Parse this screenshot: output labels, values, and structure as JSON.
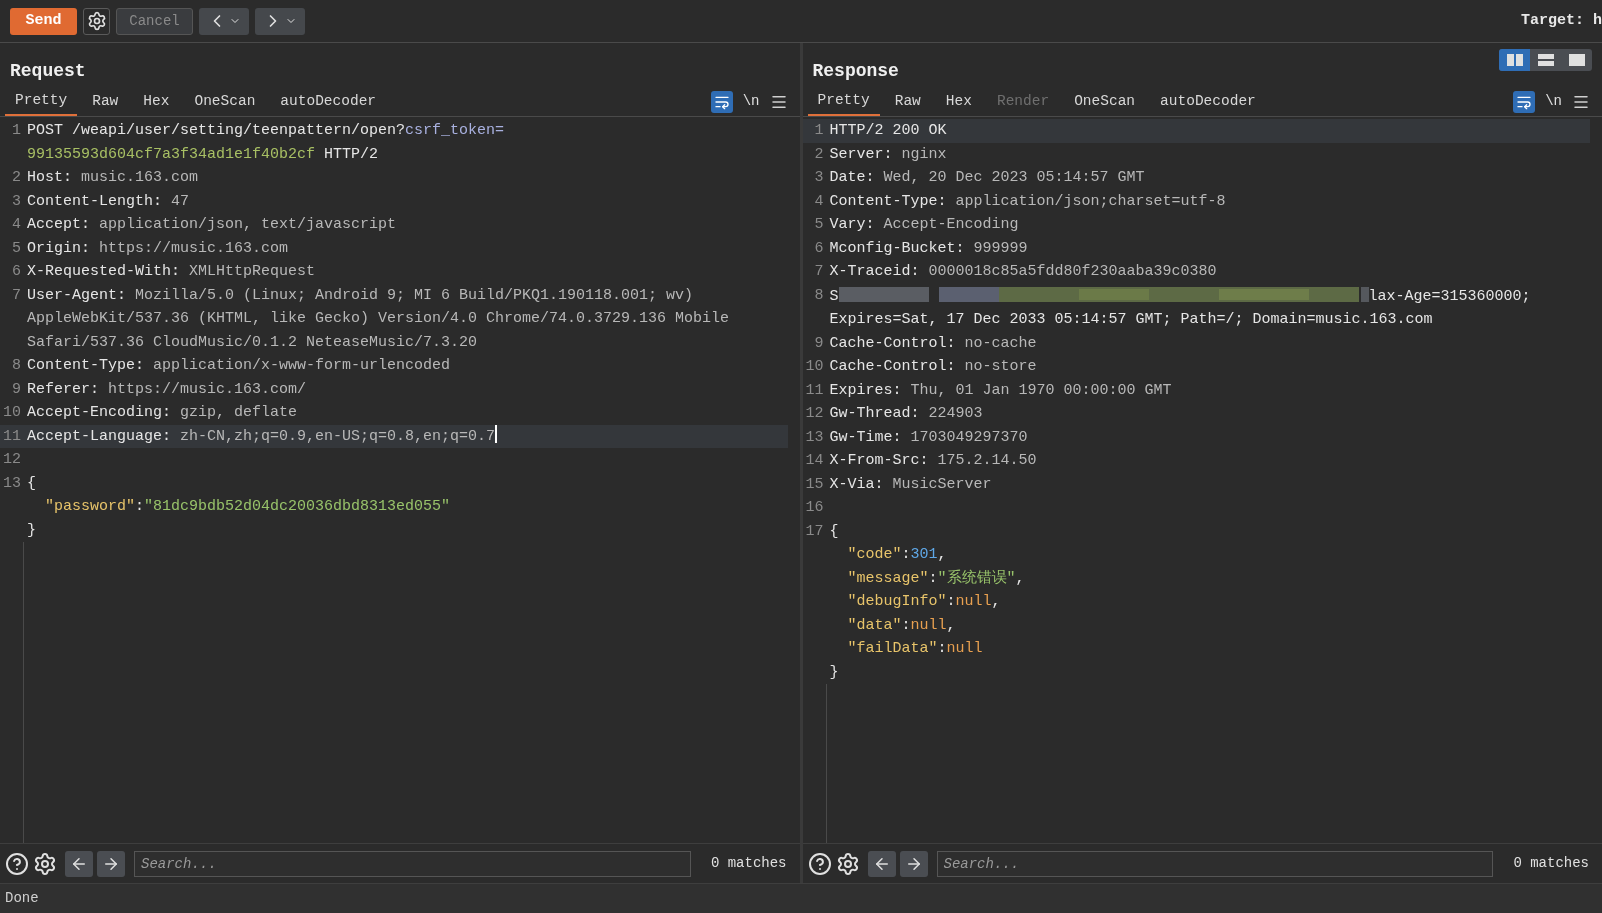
{
  "toolbar": {
    "send": "Send",
    "cancel": "Cancel",
    "cancel_disabled": true,
    "target": "Target: h"
  },
  "panels": [
    {
      "title": "Request",
      "tabs": [
        {
          "label": "Pretty",
          "selected": true,
          "disabled": false
        },
        {
          "label": "Raw",
          "selected": false,
          "disabled": false
        },
        {
          "label": "Hex",
          "selected": false,
          "disabled": false
        },
        {
          "label": "OneScan",
          "selected": false,
          "disabled": false
        },
        {
          "label": "autoDecoder",
          "selected": false,
          "disabled": false
        }
      ],
      "wrap_on": true,
      "newline_toggle": "\\n",
      "lines": [
        {
          "number": "1",
          "highlighted": false,
          "cursor": false,
          "segments": [
            {
              "kind": "key",
              "text": "POST /weapi/user/setting/teenpattern/open?"
            },
            {
              "kind": "param",
              "text": "csrf_token="
            },
            {
              "kind": "param_value",
              "text": "99135593d604cf7a3f34ad1e1f40b2cf"
            },
            {
              "kind": "key",
              "text": " HTTP/2"
            }
          ]
        },
        {
          "number": "2",
          "highlighted": false,
          "cursor": false,
          "segments": [
            {
              "kind": "key",
              "text": "Host:"
            },
            {
              "kind": "value",
              "text": " music.163.com"
            }
          ]
        },
        {
          "number": "3",
          "highlighted": false,
          "cursor": false,
          "segments": [
            {
              "kind": "key",
              "text": "Content-Length:"
            },
            {
              "kind": "value",
              "text": " 47"
            }
          ]
        },
        {
          "number": "4",
          "highlighted": false,
          "cursor": false,
          "segments": [
            {
              "kind": "key",
              "text": "Accept:"
            },
            {
              "kind": "value",
              "text": " application/json, text/javascript"
            }
          ]
        },
        {
          "number": "5",
          "highlighted": false,
          "cursor": false,
          "segments": [
            {
              "kind": "key",
              "text": "Origin:"
            },
            {
              "kind": "value",
              "text": " https://music.163.com"
            }
          ]
        },
        {
          "number": "6",
          "highlighted": false,
          "cursor": false,
          "segments": [
            {
              "kind": "key",
              "text": "X-Requested-With:"
            },
            {
              "kind": "value",
              "text": " XMLHttpRequest"
            }
          ]
        },
        {
          "number": "7",
          "highlighted": false,
          "cursor": false,
          "segments": [
            {
              "kind": "key",
              "text": "User-Agent:"
            },
            {
              "kind": "value",
              "text": " Mozilla/5.0 (Linux; Android 9; MI 6 Build/PKQ1.190118.001; wv) AppleWebKit/537.36 (KHTML, like Gecko) Version/4.0 Chrome/74.0.3729.136 Mobile Safari/537.36 CloudMusic/0.1.2 NeteaseMusic/7.3.20"
            }
          ]
        },
        {
          "number": "8",
          "highlighted": false,
          "cursor": false,
          "segments": [
            {
              "kind": "key",
              "text": "Content-Type:"
            },
            {
              "kind": "value",
              "text": " application/x-www-form-urlencoded"
            }
          ]
        },
        {
          "number": "9",
          "highlighted": false,
          "cursor": false,
          "segments": [
            {
              "kind": "key",
              "text": "Referer:"
            },
            {
              "kind": "value",
              "text": " https://music.163.com/"
            }
          ]
        },
        {
          "number": "10",
          "highlighted": false,
          "cursor": false,
          "segments": [
            {
              "kind": "key",
              "text": "Accept-Encoding:"
            },
            {
              "kind": "value",
              "text": " gzip, deflate"
            }
          ]
        },
        {
          "number": "11",
          "highlighted": true,
          "cursor": true,
          "segments": [
            {
              "kind": "key",
              "text": "Accept-Language:"
            },
            {
              "kind": "value",
              "text": " zh-CN,zh;q=0.9,en-US;q=0.8,en;q=0.7"
            }
          ]
        },
        {
          "number": "12",
          "highlighted": false,
          "cursor": false
        },
        {
          "number": "13",
          "highlighted": false,
          "cursor": false,
          "segments": [
            {
              "kind": "key",
              "text": "{\n  "
            },
            {
              "kind": "json_key",
              "text": "\"password\""
            },
            {
              "kind": "key",
              "text": ":"
            },
            {
              "kind": "json_string",
              "text": "\"81dc9bdb52d04dc20036dbd8313ed055\""
            },
            {
              "kind": "key",
              "text": "\n}"
            }
          ]
        }
      ],
      "search": {
        "placeholder": "Search...",
        "matches": "0 matches"
      }
    },
    {
      "title": "Response",
      "layout_toggle": [
        {
          "selected": true
        },
        {
          "selected": false
        },
        {
          "selected": false
        }
      ],
      "tabs": [
        {
          "label": "Pretty",
          "selected": true,
          "disabled": false
        },
        {
          "label": "Raw",
          "selected": false,
          "disabled": false
        },
        {
          "label": "Hex",
          "selected": false,
          "disabled": false
        },
        {
          "label": "Render",
          "selected": false,
          "disabled": true
        },
        {
          "label": "OneScan",
          "selected": false,
          "disabled": false
        },
        {
          "label": "autoDecoder",
          "selected": false,
          "disabled": false
        }
      ],
      "wrap_on": true,
      "newline_toggle": "\\n",
      "lines": [
        {
          "number": "1",
          "highlighted": true,
          "cursor": false,
          "segments": [
            {
              "kind": "key",
              "text": "HTTP/2 200 OK"
            }
          ]
        },
        {
          "number": "2",
          "highlighted": false,
          "cursor": false,
          "segments": [
            {
              "kind": "key",
              "text": "Server:"
            },
            {
              "kind": "value",
              "text": " nginx"
            }
          ]
        },
        {
          "number": "3",
          "highlighted": false,
          "cursor": false,
          "segments": [
            {
              "kind": "key",
              "text": "Date:"
            },
            {
              "kind": "value",
              "text": " Wed, 20 Dec 2023 05:14:57 GMT"
            }
          ]
        },
        {
          "number": "4",
          "highlighted": false,
          "cursor": false,
          "segments": [
            {
              "kind": "key",
              "text": "Content-Type:"
            },
            {
              "kind": "value",
              "text": " application/json;charset=utf-8"
            }
          ]
        },
        {
          "number": "5",
          "highlighted": false,
          "cursor": false,
          "segments": [
            {
              "kind": "key",
              "text": "Vary:"
            },
            {
              "kind": "value",
              "text": " Accept-Encoding"
            }
          ]
        },
        {
          "number": "6",
          "highlighted": false,
          "cursor": false,
          "segments": [
            {
              "kind": "key",
              "text": "Mconfig-Bucket:"
            },
            {
              "kind": "value",
              "text": " 999999"
            }
          ]
        },
        {
          "number": "7",
          "highlighted": false,
          "cursor": false,
          "segments": [
            {
              "kind": "key",
              "text": "X-Traceid:"
            },
            {
              "kind": "value",
              "text": " 0000018c85a5fdd80f230aaba39c0380"
            }
          ]
        },
        {
          "number": "8",
          "highlighted": false,
          "cursor": false,
          "segments": [
            {
              "kind": "key",
              "text": "S"
            },
            {
              "kind": "redacted"
            },
            {
              "kind": "key",
              "text": "lax-Age=315360000; Expires=Sat, 17 Dec 2033 05:14:57 GMT; Path=/; Domain=music.163.com"
            }
          ]
        },
        {
          "number": "9",
          "highlighted": false,
          "cursor": false,
          "segments": [
            {
              "kind": "key",
              "text": "Cache-Control:"
            },
            {
              "kind": "value",
              "text": " no-cache"
            }
          ]
        },
        {
          "number": "10",
          "highlighted": false,
          "cursor": false,
          "segments": [
            {
              "kind": "key",
              "text": "Cache-Control:"
            },
            {
              "kind": "value",
              "text": " no-store"
            }
          ]
        },
        {
          "number": "11",
          "highlighted": false,
          "cursor": false,
          "segments": [
            {
              "kind": "key",
              "text": "Expires:"
            },
            {
              "kind": "value",
              "text": " Thu, 01 Jan 1970 00:00:00 GMT"
            }
          ]
        },
        {
          "number": "12",
          "highlighted": false,
          "cursor": false,
          "segments": [
            {
              "kind": "key",
              "text": "Gw-Thread:"
            },
            {
              "kind": "value",
              "text": " 224903"
            }
          ]
        },
        {
          "number": "13",
          "highlighted": false,
          "cursor": false,
          "segments": [
            {
              "kind": "key",
              "text": "Gw-Time:"
            },
            {
              "kind": "value",
              "text": " 1703049297370"
            }
          ]
        },
        {
          "number": "14",
          "highlighted": false,
          "cursor": false,
          "segments": [
            {
              "kind": "key",
              "text": "X-From-Src:"
            },
            {
              "kind": "value",
              "text": " 175.2.14.50"
            }
          ]
        },
        {
          "number": "15",
          "highlighted": false,
          "cursor": false,
          "segments": [
            {
              "kind": "key",
              "text": "X-Via:"
            },
            {
              "kind": "value",
              "text": " MusicServer"
            }
          ]
        },
        {
          "number": "16",
          "highlighted": false,
          "cursor": false
        },
        {
          "number": "17",
          "highlighted": false,
          "cursor": false,
          "segments": [
            {
              "kind": "key",
              "text": "{\n  "
            },
            {
              "kind": "json_key",
              "text": "\"code\""
            },
            {
              "kind": "key",
              "text": ":"
            },
            {
              "kind": "json_number",
              "text": "301"
            },
            {
              "kind": "key",
              "text": ",\n  "
            },
            {
              "kind": "json_key",
              "text": "\"message\""
            },
            {
              "kind": "key",
              "text": ":"
            },
            {
              "kind": "json_string",
              "text": "\"系统错误\""
            },
            {
              "kind": "key",
              "text": ",\n  "
            },
            {
              "kind": "json_key",
              "text": "\"debugInfo\""
            },
            {
              "kind": "key",
              "text": ":"
            },
            {
              "kind": "json_null",
              "text": "null"
            },
            {
              "kind": "key",
              "text": ",\n  "
            },
            {
              "kind": "json_key",
              "text": "\"data\""
            },
            {
              "kind": "key",
              "text": ":"
            },
            {
              "kind": "json_null",
              "text": "null"
            },
            {
              "kind": "key",
              "text": ",\n  "
            },
            {
              "kind": "json_key",
              "text": "\"failData\""
            },
            {
              "kind": "key",
              "text": ":"
            },
            {
              "kind": "json_null",
              "text": "null"
            },
            {
              "kind": "key",
              "text": "\n}"
            }
          ]
        }
      ],
      "search": {
        "placeholder": "Search...",
        "matches": "0 matches"
      }
    }
  ],
  "status_bar": "Done"
}
